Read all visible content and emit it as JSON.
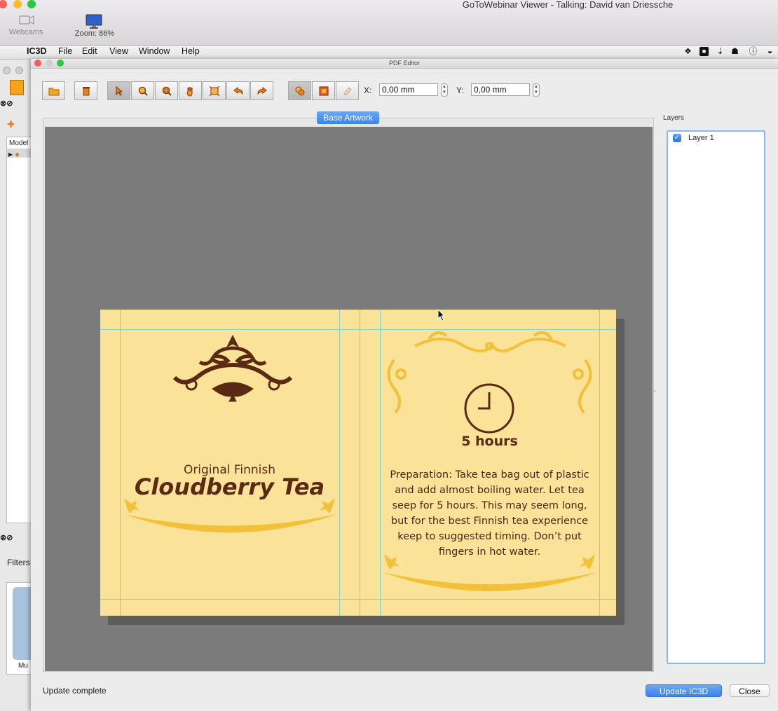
{
  "viewer": {
    "title": "GoToWebinar Viewer - Talking: David van Driessche",
    "webcams_label": "Webcams",
    "zoom_label": "Zoom: 86%"
  },
  "menubar": {
    "app": "IC3D",
    "items": [
      "File",
      "Edit",
      "View",
      "Window",
      "Help"
    ],
    "status_icons": [
      "dropbox-icon",
      "screen-icon",
      "upload-icon",
      "hat-icon",
      "info-icon",
      "spy-icon"
    ]
  },
  "background_window": {
    "column_header": "Model",
    "filters_label": "Filters",
    "thumb_label": "Mu"
  },
  "pdf_editor": {
    "title": "PDF Editor",
    "toolbar": {
      "tools": [
        "open-folder",
        "trash",
        "select-arrow",
        "zoom",
        "zoom-area",
        "pan-hand",
        "fit-page",
        "undo",
        "redo",
        "shapes",
        "image",
        "eraser"
      ],
      "x_label": "X:",
      "x_value": "0,00 mm",
      "y_label": "Y:",
      "y_value": "0,00 mm"
    },
    "base_tab": "Base Artwork",
    "artwork": {
      "subtitle": "Original Finnish",
      "title": "Cloudberry Tea",
      "hours": "5 hours",
      "instructions": [
        "Preparation: Take tea bag out of plastic",
        "and add almost boiling water. Let tea",
        "seep for 5 hours. This may seem long,",
        "but for the best Finnish tea experience",
        "keep to suggested timing. Don’t put",
        "fingers in hot water."
      ],
      "colors": {
        "paper": "#fae398",
        "brown": "#5a2a14",
        "gold": "#f3c03a"
      }
    },
    "layers": {
      "label": "Layers",
      "items": [
        {
          "name": "Layer 1",
          "checked": true
        }
      ]
    },
    "status": "Update complete",
    "update_button": "Update IC3D",
    "close_button": "Close"
  },
  "accent_color": "#3c82ec"
}
